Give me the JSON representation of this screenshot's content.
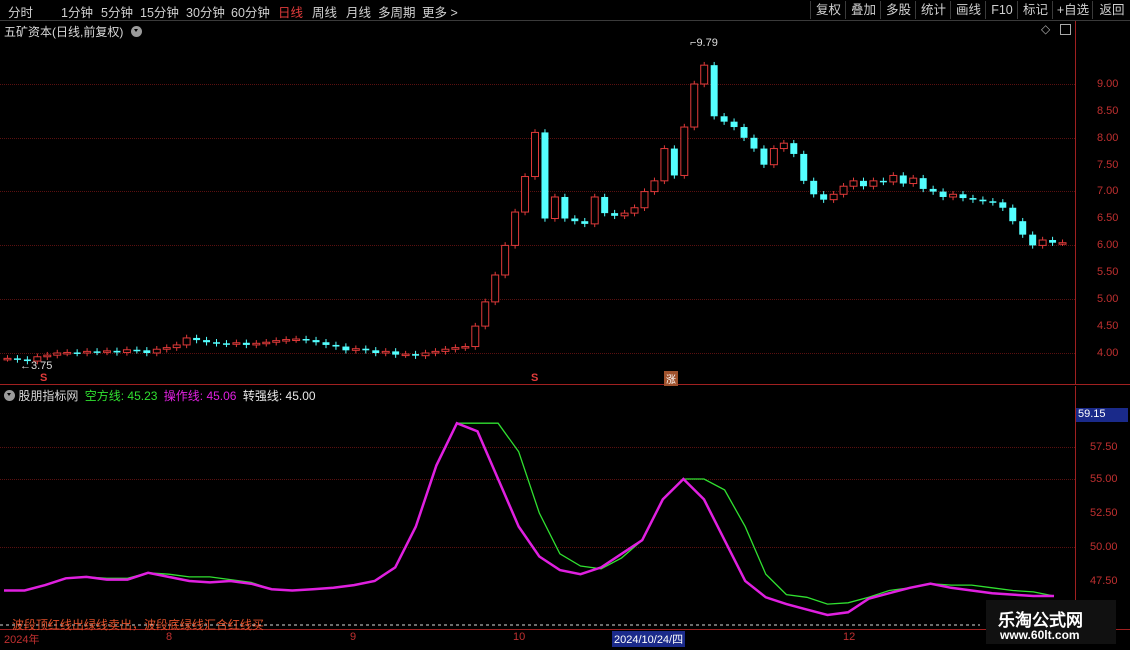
{
  "toolbar": {
    "periods": [
      {
        "label": "分时",
        "active": false
      },
      {
        "label": "1分钟",
        "active": false
      },
      {
        "label": "5分钟",
        "active": false
      },
      {
        "label": "15分钟",
        "active": false
      },
      {
        "label": "30分钟",
        "active": false
      },
      {
        "label": "60分钟",
        "active": false
      },
      {
        "label": "日线",
        "active": true
      },
      {
        "label": "周线",
        "active": false
      },
      {
        "label": "月线",
        "active": false
      },
      {
        "label": "多周期",
        "active": false
      },
      {
        "label": "更多 >",
        "active": false
      }
    ],
    "tools": [
      "复权",
      "叠加",
      "多股",
      "统计",
      "画线",
      "F10",
      "标记",
      "+自选",
      "返回"
    ]
  },
  "main_panel": {
    "title": "五矿资本(日线,前复权)",
    "high_label": "9.79",
    "low_label": "3.75",
    "marker_s1": "S",
    "marker_s2": "S",
    "marker_tag": "涨",
    "y_labels": [
      "9.00",
      "8.50",
      "8.00",
      "7.50",
      "7.00",
      "6.50",
      "6.00",
      "5.50",
      "5.00",
      "4.50",
      "4.00"
    ]
  },
  "indicator_panel": {
    "name": "股朋指标网",
    "line1_label": "空方线:",
    "line1_value": "45.23",
    "line2_label": "操作线:",
    "line2_value": "45.06",
    "line3_label": "转强线:",
    "line3_value": "45.00",
    "current_value": "59.15",
    "y_labels": [
      "57.50",
      "55.00",
      "52.50",
      "50.00",
      "47.50"
    ],
    "hint": "波段顶红线出绿线卖出，波段底绿线汇合红线买"
  },
  "x_axis": {
    "labels": [
      "2024年",
      "8",
      "9",
      "10",
      "12"
    ],
    "cursor_date": "2024/10/24/四"
  },
  "colors": {
    "up": "#e03a3a",
    "down": "#54ffff",
    "operate_line": "#e020e0",
    "empty_line": "#30e030",
    "axis": "#c03030"
  },
  "chart_data": {
    "type": "candlestick",
    "x_start": "2024-07",
    "x_end": "2024-12",
    "y_range_price": [
      3.6,
      10.0
    ],
    "candles_close": [
      3.9,
      3.88,
      3.85,
      3.93,
      3.96,
      4.0,
      4.01,
      4.0,
      4.03,
      4.02,
      4.04,
      4.01,
      4.06,
      4.05,
      4.0,
      4.07,
      4.1,
      4.15,
      4.28,
      4.24,
      4.2,
      4.18,
      4.17,
      4.19,
      4.15,
      4.18,
      4.2,
      4.23,
      4.25,
      4.26,
      4.24,
      4.2,
      4.15,
      4.12,
      4.05,
      4.08,
      4.05,
      4.0,
      4.03,
      3.97,
      3.98,
      3.95,
      4.0,
      4.03,
      4.07,
      4.1,
      4.12,
      4.5,
      4.95,
      5.45,
      6.0,
      6.62,
      7.28,
      8.1,
      6.5,
      6.9,
      6.5,
      6.45,
      6.4,
      6.9,
      6.6,
      6.55,
      6.6,
      6.7,
      7.0,
      7.2,
      7.8,
      7.3,
      8.2,
      9.0,
      9.35,
      8.4,
      8.3,
      8.2,
      8.0,
      7.8,
      7.5,
      7.8,
      7.9,
      7.7,
      7.2,
      6.95,
      6.85,
      6.95,
      7.1,
      7.2,
      7.1,
      7.2,
      7.18,
      7.3,
      7.15,
      7.25,
      7.05,
      7.0,
      6.9,
      6.95,
      6.88,
      6.85,
      6.82,
      6.8,
      6.7,
      6.45,
      6.2,
      6.0,
      6.1,
      6.05,
      6.05
    ],
    "indicator": {
      "y_range": [
        45.0,
        60.0
      ],
      "operate_line": [
        46.8,
        46.8,
        47.2,
        47.7,
        47.8,
        47.6,
        47.6,
        48.1,
        47.8,
        47.5,
        47.4,
        47.5,
        47.3,
        46.9,
        46.8,
        46.9,
        47.0,
        47.2,
        47.5,
        48.5,
        51.5,
        56.0,
        59.1,
        58.5,
        55.0,
        51.5,
        49.3,
        48.3,
        48.0,
        48.5,
        49.5,
        50.5,
        53.5,
        55.0,
        53.5,
        50.5,
        47.5,
        46.3,
        45.8,
        45.4,
        45.0,
        45.2,
        46.2,
        46.6,
        47.0,
        47.3,
        47.0,
        46.8,
        46.6,
        46.5,
        46.4,
        46.4
      ],
      "empty_line": [
        46.8,
        46.8,
        47.2,
        47.7,
        47.8,
        47.7,
        47.7,
        48.1,
        48.0,
        47.8,
        47.8,
        47.6,
        47.4,
        46.9,
        46.8,
        46.9,
        47.0,
        47.2,
        47.5,
        48.5,
        51.5,
        56.0,
        59.1,
        59.1,
        59.1,
        57.0,
        52.5,
        49.5,
        48.6,
        48.4,
        49.2,
        50.5,
        53.5,
        55.0,
        55.0,
        54.2,
        51.5,
        48.0,
        46.5,
        46.3,
        45.8,
        45.9,
        46.3,
        46.8,
        47.0,
        47.3,
        47.2,
        47.2,
        47.0,
        46.8,
        46.7,
        46.4
      ],
      "strong_line": 45.0
    }
  }
}
